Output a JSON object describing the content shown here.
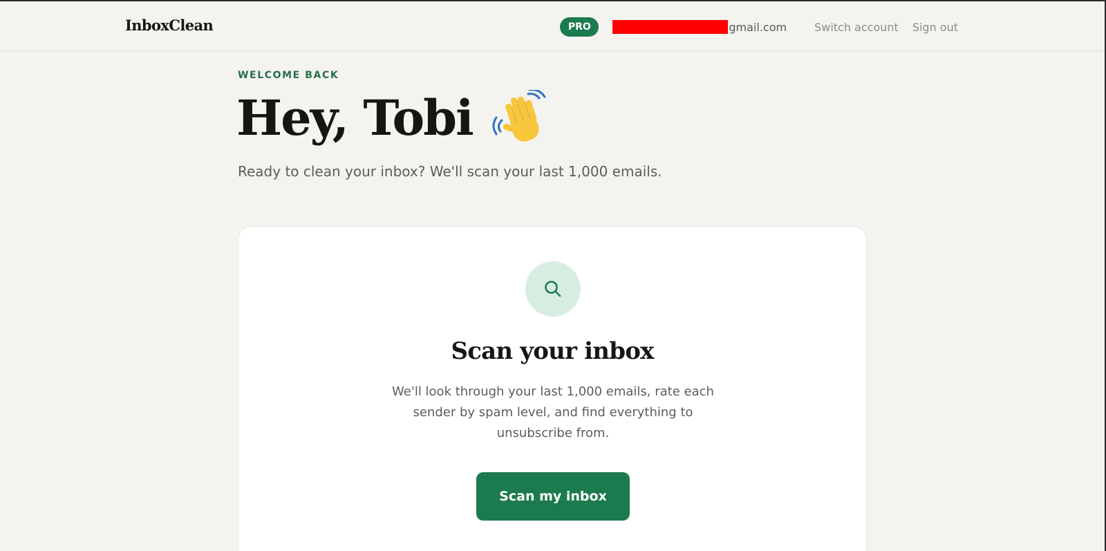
{
  "header": {
    "brand": "InboxClean",
    "plan_badge": "PRO",
    "email_suffix": "gmail.com",
    "switch_account": "Switch account",
    "sign_out": "Sign out"
  },
  "welcome": {
    "eyebrow": "WELCOME BACK",
    "greeting": "Hey, Tobi",
    "subtitle": "Ready to clean your inbox? We'll scan your last 1,000 emails."
  },
  "scan_card": {
    "icon": "search-icon",
    "title": "Scan your inbox",
    "description": "We'll look through your last 1,000 emails, rate each sender by spam level, and find everything to unsubscribe from.",
    "button_label": "Scan my inbox"
  },
  "colors": {
    "accent": "#1c7a4f",
    "accent_light": "#d7ede1",
    "background": "#f4f3ef",
    "redaction": "#ff0000"
  }
}
